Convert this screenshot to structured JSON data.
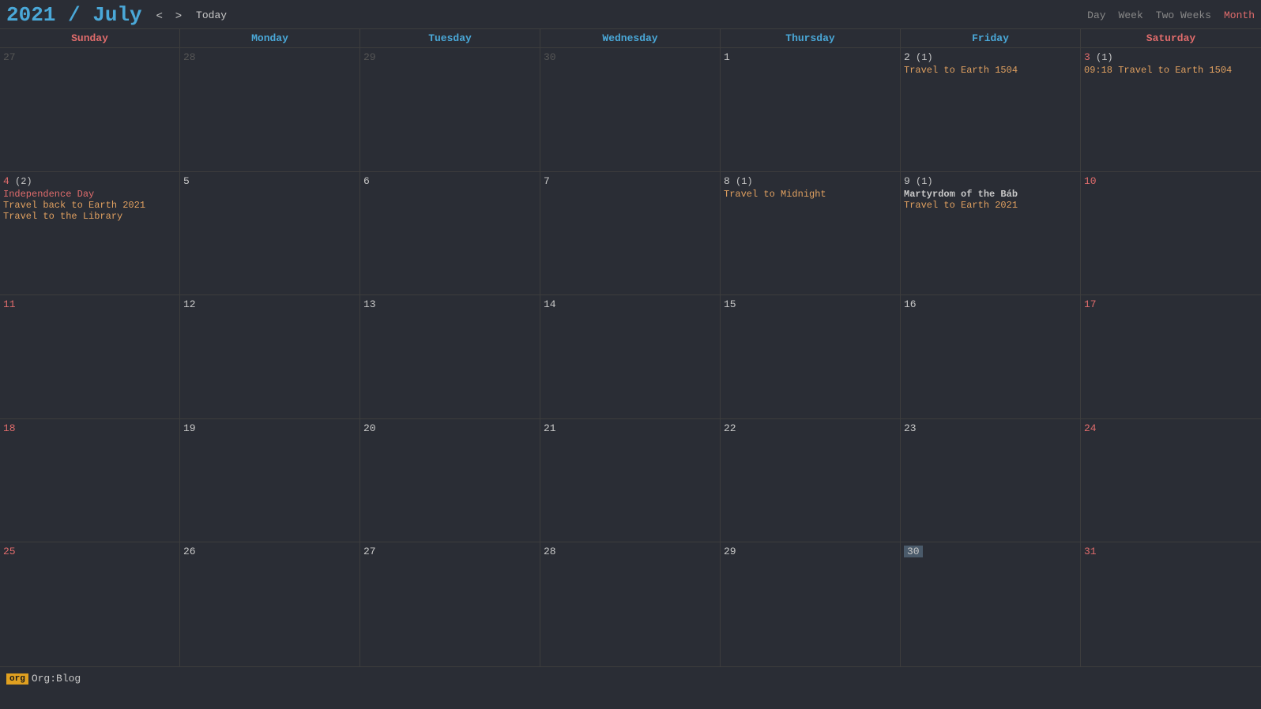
{
  "header": {
    "title": "2021 / July",
    "year": "2021",
    "slash": " / ",
    "month": "July",
    "nav": {
      "prev": "<",
      "next": ">",
      "today": "Today"
    },
    "views": {
      "day": "Day",
      "week": "Week",
      "twoWeeks": "Two Weeks",
      "month": "Month"
    }
  },
  "dayHeaders": [
    {
      "label": "Sunday",
      "type": "weekend"
    },
    {
      "label": "Monday",
      "type": "weekday"
    },
    {
      "label": "Tuesday",
      "type": "weekday"
    },
    {
      "label": "Wednesday",
      "type": "weekday"
    },
    {
      "label": "Thursday",
      "type": "weekday"
    },
    {
      "label": "Friday",
      "type": "weekday"
    },
    {
      "label": "Saturday",
      "type": "weekend"
    }
  ],
  "weeks": [
    {
      "days": [
        {
          "num": "27",
          "otherMonth": true,
          "weekend": true,
          "events": []
        },
        {
          "num": "28",
          "otherMonth": true,
          "weekend": false,
          "events": []
        },
        {
          "num": "29",
          "otherMonth": true,
          "weekend": false,
          "events": []
        },
        {
          "num": "30",
          "otherMonth": true,
          "weekend": false,
          "events": []
        },
        {
          "num": "1",
          "otherMonth": false,
          "weekend": false,
          "events": []
        },
        {
          "num": "2",
          "otherMonth": false,
          "weekend": false,
          "count": "(1)",
          "events": [
            {
              "type": "travel",
              "text": "Travel to Earth 1504"
            }
          ]
        },
        {
          "num": "3",
          "otherMonth": false,
          "weekend": true,
          "count": "(1)",
          "events": [
            {
              "type": "travel-time",
              "text": "09:18 Travel to Earth 1504"
            }
          ]
        }
      ]
    },
    {
      "days": [
        {
          "num": "4",
          "otherMonth": false,
          "weekend": true,
          "count": "(2)",
          "events": [
            {
              "type": "holiday-red",
              "text": "Independence Day"
            },
            {
              "type": "travel",
              "text": "Travel back to Earth 2021"
            },
            {
              "type": "travel",
              "text": "Travel to the Library"
            }
          ]
        },
        {
          "num": "5",
          "otherMonth": false,
          "weekend": false,
          "events": []
        },
        {
          "num": "6",
          "otherMonth": false,
          "weekend": false,
          "events": []
        },
        {
          "num": "7",
          "otherMonth": false,
          "weekend": false,
          "events": []
        },
        {
          "num": "8",
          "otherMonth": false,
          "weekend": false,
          "count": "(1)",
          "events": [
            {
              "type": "midnight",
              "text": "Travel to Midnight"
            }
          ]
        },
        {
          "num": "9",
          "otherMonth": false,
          "weekend": false,
          "count": "(1)",
          "events": [
            {
              "type": "holiday",
              "text": "Martyrdom of the Báb"
            },
            {
              "type": "travel",
              "text": "Travel to Earth 2021"
            }
          ]
        },
        {
          "num": "10",
          "otherMonth": false,
          "weekend": true,
          "events": []
        }
      ]
    },
    {
      "days": [
        {
          "num": "11",
          "otherMonth": false,
          "weekend": true,
          "events": []
        },
        {
          "num": "12",
          "otherMonth": false,
          "weekend": false,
          "events": []
        },
        {
          "num": "13",
          "otherMonth": false,
          "weekend": false,
          "events": []
        },
        {
          "num": "14",
          "otherMonth": false,
          "weekend": false,
          "events": []
        },
        {
          "num": "15",
          "otherMonth": false,
          "weekend": false,
          "events": []
        },
        {
          "num": "16",
          "otherMonth": false,
          "weekend": false,
          "events": []
        },
        {
          "num": "17",
          "otherMonth": false,
          "weekend": true,
          "events": []
        }
      ]
    },
    {
      "days": [
        {
          "num": "18",
          "otherMonth": false,
          "weekend": true,
          "events": []
        },
        {
          "num": "19",
          "otherMonth": false,
          "weekend": false,
          "events": []
        },
        {
          "num": "20",
          "otherMonth": false,
          "weekend": false,
          "events": []
        },
        {
          "num": "21",
          "otherMonth": false,
          "weekend": false,
          "events": []
        },
        {
          "num": "22",
          "otherMonth": false,
          "weekend": false,
          "events": []
        },
        {
          "num": "23",
          "otherMonth": false,
          "weekend": false,
          "events": []
        },
        {
          "num": "24",
          "otherMonth": false,
          "weekend": true,
          "events": []
        }
      ]
    },
    {
      "days": [
        {
          "num": "25",
          "otherMonth": false,
          "weekend": true,
          "events": []
        },
        {
          "num": "26",
          "otherMonth": false,
          "weekend": false,
          "events": []
        },
        {
          "num": "27",
          "otherMonth": false,
          "weekend": false,
          "events": []
        },
        {
          "num": "28",
          "otherMonth": false,
          "weekend": false,
          "events": []
        },
        {
          "num": "29",
          "otherMonth": false,
          "weekend": false,
          "events": []
        },
        {
          "num": "30",
          "otherMonth": false,
          "weekend": false,
          "today": true,
          "events": []
        },
        {
          "num": "31",
          "otherMonth": false,
          "weekend": true,
          "events": []
        }
      ]
    }
  ],
  "footer": {
    "tag": "org",
    "label": "Org:Blog"
  },
  "colors": {
    "bg": "#2a2d35",
    "accent": "#4aa8d8",
    "weekend": "#e06c6c",
    "travel": "#e0a060",
    "border": "#3d3d3d",
    "text": "#c8c8c8",
    "dimText": "#555",
    "today": "#4a5a6a"
  }
}
